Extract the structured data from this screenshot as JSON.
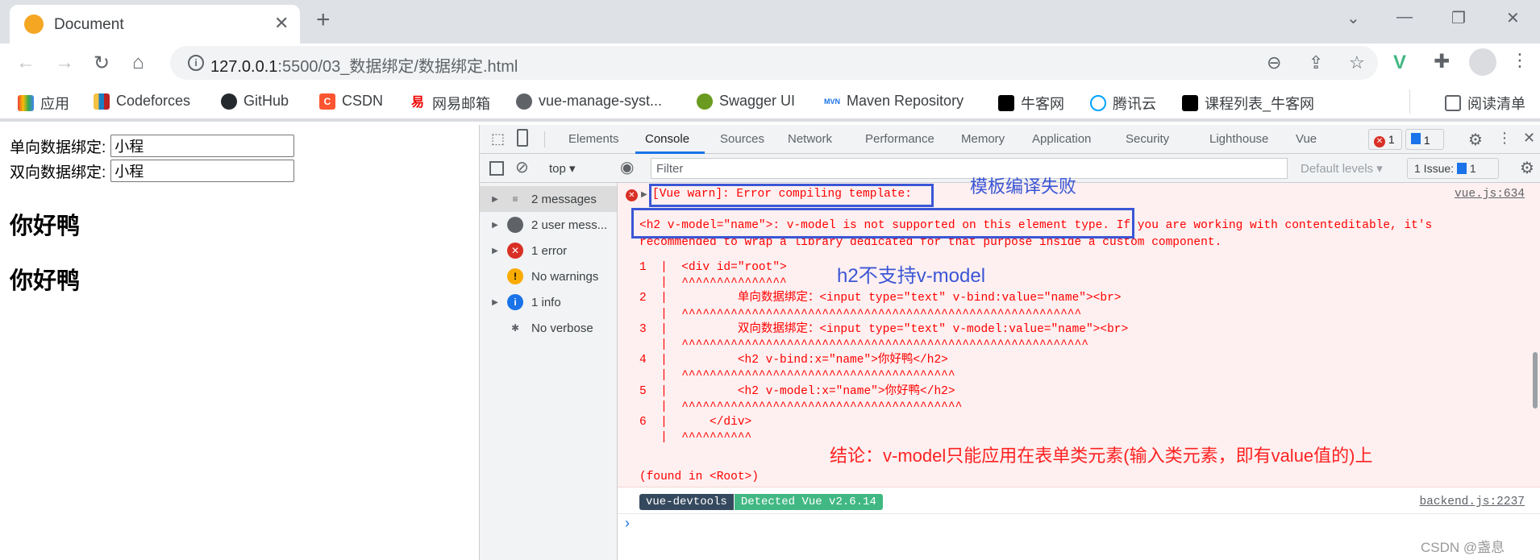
{
  "browser": {
    "tab_title": "Document",
    "url_host": "127.0.0.1",
    "url_rest": ":5500/03_数据绑定/数据绑定.html",
    "bookmarks": [
      {
        "label": "应用",
        "icon": "apps-grid-icon"
      },
      {
        "label": "Codeforces",
        "icon": "codeforces-icon"
      },
      {
        "label": "GitHub",
        "icon": "github-icon"
      },
      {
        "label": "CSDN",
        "icon": "csdn-icon"
      },
      {
        "label": "网易邮箱",
        "icon": "netease-mail-icon"
      },
      {
        "label": "vue-manage-syst...",
        "icon": "globe-icon"
      },
      {
        "label": "Swagger UI",
        "icon": "swagger-icon"
      },
      {
        "label": "Maven Repository",
        "icon": "maven-icon"
      },
      {
        "label": "牛客网",
        "icon": "nowcoder-icon"
      },
      {
        "label": "腾讯云",
        "icon": "tencent-cloud-icon"
      },
      {
        "label": "课程列表_牛客网",
        "icon": "nowcoder-icon"
      }
    ],
    "reading_list": "阅读清单"
  },
  "page": {
    "one_way_label": "单向数据绑定:",
    "one_way_value": "小程",
    "two_way_label": "双向数据绑定:",
    "two_way_value": "小程",
    "heading1": "你好鸭",
    "heading2": "你好鸭"
  },
  "devtools": {
    "tabs": [
      "Elements",
      "Console",
      "Sources",
      "Network",
      "Performance",
      "Memory",
      "Application",
      "Security",
      "Lighthouse",
      "Vue"
    ],
    "active_tab": "Console",
    "error_count": "1",
    "message_count": "1",
    "context": "top",
    "filter_placeholder": "Filter",
    "levels": "Default levels",
    "issues": "1 Issue:",
    "issues_count": "1",
    "sidebar": [
      {
        "label": "2 messages",
        "icon": "list-icon"
      },
      {
        "label": "2 user mess...",
        "icon": "user-icon"
      },
      {
        "label": "1 error",
        "icon": "error-icon"
      },
      {
        "label": "No warnings",
        "icon": "warning-icon"
      },
      {
        "label": "1 info",
        "icon": "info-icon"
      },
      {
        "label": "No verbose",
        "icon": "bug-icon"
      }
    ],
    "console": {
      "warn_header": "[Vue warn]: Error compiling template:",
      "source1": "vue.js:634",
      "msg_line1": "<h2 v-model=\"name\">: v-model is not supported on this element type. If you are working with contenteditable, it's",
      "msg_line2": "recommended to wrap a library dedicated for that purpose inside a custom component.",
      "code_lines": [
        "1  |  <div id=\"root\">",
        "   |  ^^^^^^^^^^^^^^^",
        "2  |          单向数据绑定：<input type=\"text\" v-bind:value=\"name\"><br>",
        "   |  ^^^^^^^^^^^^^^^^^^^^^^^^^^^^^^^^^^^^^^^^^^^^^^^^^^^^^^^^^",
        "3  |          双向数据绑定：<input type=\"text\" v-model:value=\"name\"><br>",
        "   |  ^^^^^^^^^^^^^^^^^^^^^^^^^^^^^^^^^^^^^^^^^^^^^^^^^^^^^^^^^^",
        "4  |          <h2 v-bind:x=\"name\">你好鸭</h2>",
        "   |  ^^^^^^^^^^^^^^^^^^^^^^^^^^^^^^^^^^^^^^^",
        "5  |          <h2 v-model:x=\"name\">你好鸭</h2>",
        "   |  ^^^^^^^^^^^^^^^^^^^^^^^^^^^^^^^^^^^^^^^^",
        "6  |      </div>",
        "   |  ^^^^^^^^^^"
      ],
      "found_in": "(found in <Root>)",
      "badge_left": "vue-devtools",
      "badge_right": "Detected Vue v2.6.14",
      "source2": "backend.js:2237",
      "prompt": "›"
    }
  },
  "annotations": {
    "compile_fail": "模板编译失败",
    "h2_not_supported": "h2不支持v-model",
    "conclusion": "结论：v-model只能应用在表单类元素(输入类元素，即有value值的)上"
  },
  "watermark": "CSDN @盏息",
  "colors": {
    "error_red": "#ff0000",
    "annotation_blue": "#3b56d6",
    "vue_green": "#41b883",
    "devtools_dark": "#35495e"
  }
}
